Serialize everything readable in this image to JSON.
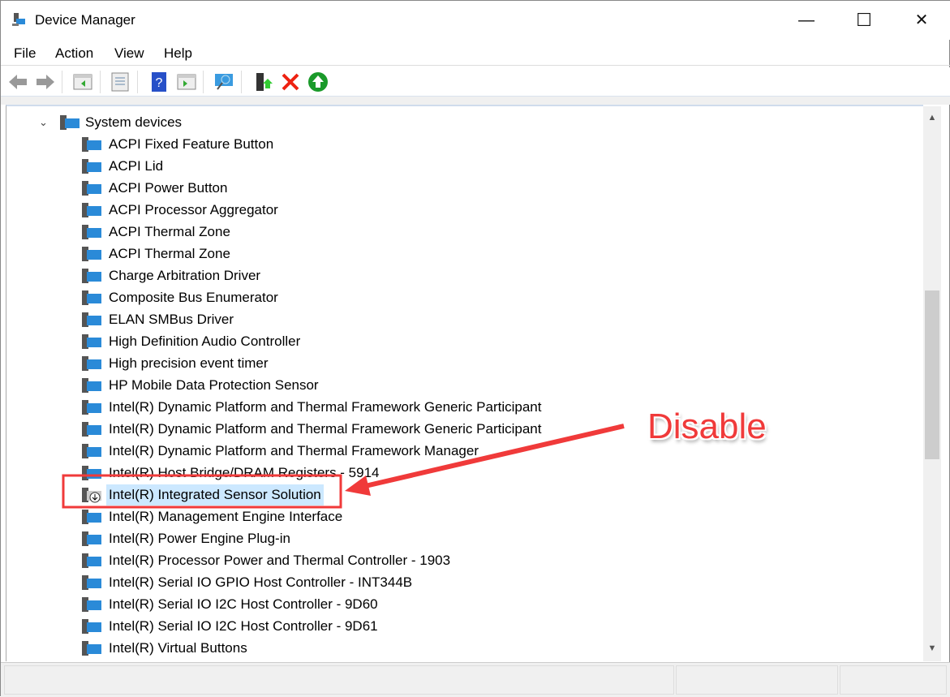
{
  "window": {
    "title": "Device Manager",
    "minimize": "—",
    "maximize": "☐",
    "close": "✕"
  },
  "menu": [
    "File",
    "Action",
    "View",
    "Help"
  ],
  "toolbar": [
    "back-icon",
    "forward-icon",
    "show-hide-console-tree-icon",
    "properties-icon",
    "help-icon",
    "show-action-pane-icon",
    "scan-hardware-icon",
    "update-driver-icon",
    "uninstall-icon",
    "enable-device-icon"
  ],
  "tree": {
    "category": "System devices",
    "items": [
      "ACPI Fixed Feature Button",
      "ACPI Lid",
      "ACPI Power Button",
      "ACPI Processor Aggregator",
      "ACPI Thermal Zone",
      "ACPI Thermal Zone",
      "Charge Arbitration Driver",
      "Composite Bus Enumerator",
      "ELAN SMBus Driver",
      "High Definition Audio Controller",
      "High precision event timer",
      "HP Mobile Data Protection Sensor",
      "Intel(R) Dynamic Platform and Thermal Framework Generic Participant",
      "Intel(R) Dynamic Platform and Thermal Framework Generic Participant",
      "Intel(R) Dynamic Platform and Thermal Framework Manager",
      "Intel(R) Host Bridge/DRAM Registers - 5914",
      "Intel(R) Integrated Sensor Solution",
      "Intel(R) Management Engine Interface",
      "Intel(R) Power Engine Plug-in",
      "Intel(R) Processor Power and Thermal Controller - 1903",
      "Intel(R) Serial IO GPIO Host Controller - INT344B",
      "Intel(R) Serial IO I2C Host Controller - 9D60",
      "Intel(R) Serial IO I2C Host Controller - 9D61",
      "Intel(R) Virtual Buttons"
    ],
    "selected_index": 16
  },
  "annotation": {
    "label": "Disable",
    "color": "#f03a3a"
  }
}
